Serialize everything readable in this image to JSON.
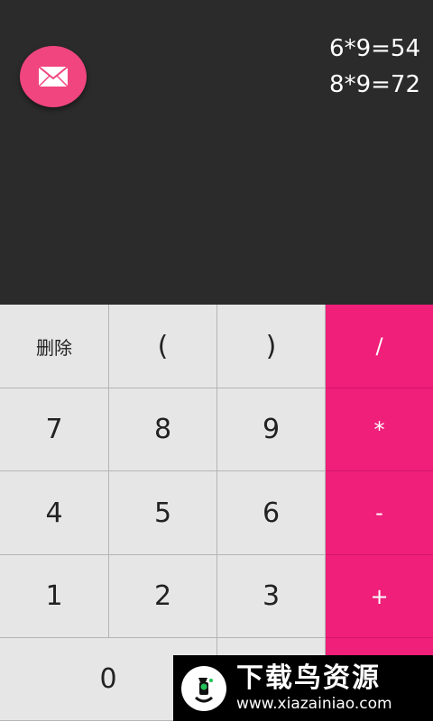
{
  "display": {
    "history": [
      "6*9=54",
      "8*9=72"
    ]
  },
  "fab": {
    "icon": "mail-icon",
    "color": "#f0457f"
  },
  "keypad": {
    "keys": {
      "delete": "删除",
      "open_paren": "(",
      "close_paren": ")",
      "divide": "/",
      "seven": "7",
      "eight": "8",
      "nine": "9",
      "multiply": "*",
      "four": "4",
      "five": "5",
      "six": "6",
      "minus": "-",
      "one": "1",
      "two": "2",
      "three": "3",
      "plus": "+",
      "zero": "0"
    },
    "colors": {
      "key_bg": "#e6e6e6",
      "operator_bg": "#ef1f7a",
      "display_bg": "#2b2b2b"
    }
  },
  "watermark": {
    "title": "下载鸟资源",
    "url": "www.xiazainiao.com"
  }
}
